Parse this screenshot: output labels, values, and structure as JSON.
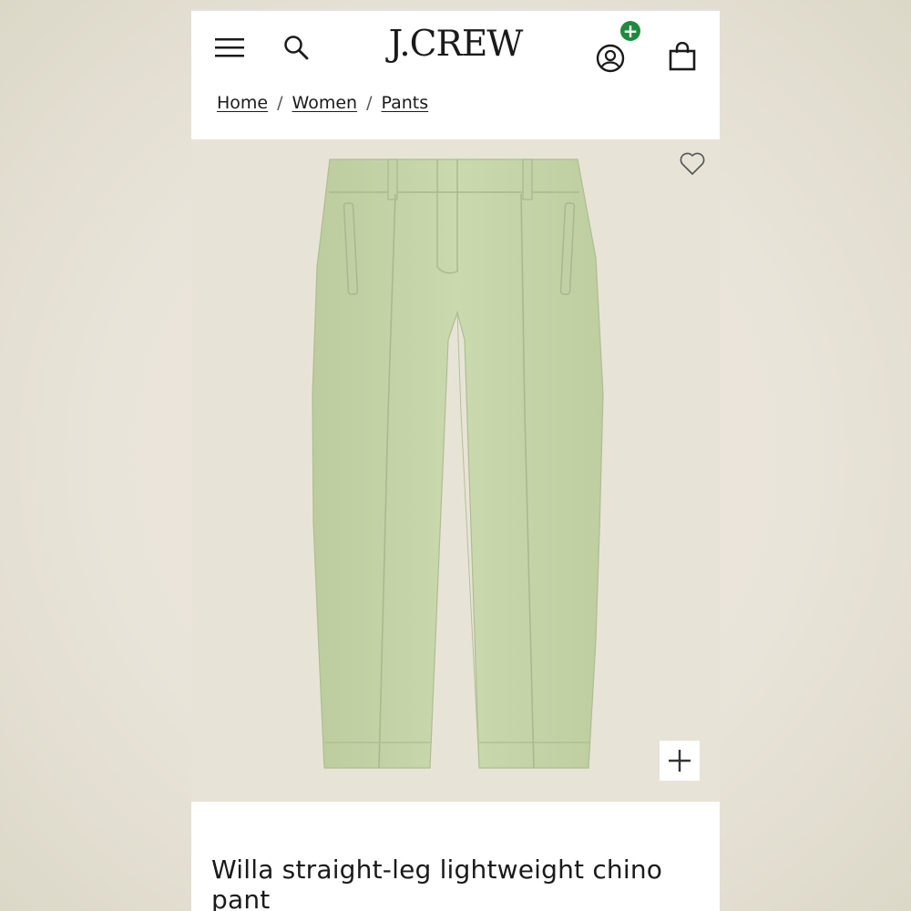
{
  "header": {
    "logo": "J.CREW",
    "account_badge": "+"
  },
  "breadcrumb": {
    "items": [
      "Home",
      "Women",
      "Pants"
    ],
    "separator": "/"
  },
  "product": {
    "title": "Willa straight-leg lightweight chino pant",
    "color_swatch": "#c6d6aa"
  },
  "colors": {
    "badge": "#1f8a3e",
    "image_bg": "#e8e3d7"
  }
}
